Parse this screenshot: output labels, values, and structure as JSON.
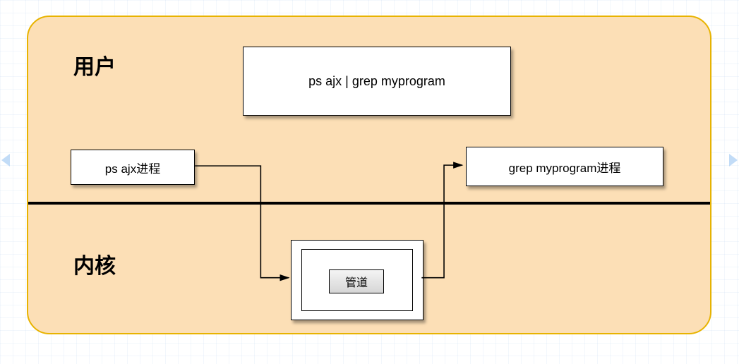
{
  "labels": {
    "user_section": "用户",
    "kernel_section": "内核",
    "command_box": "ps  ajx | grep myprogram",
    "ps_process": "ps  ajx进程",
    "grep_process": "grep myprogram进程",
    "pipe_label": "管道"
  },
  "diagram": {
    "flow": [
      "ps_process → pipe (down)",
      "pipe → grep_process (up)"
    ],
    "container": {
      "fill": "#fcdfb6",
      "border": "#e8b300"
    }
  }
}
